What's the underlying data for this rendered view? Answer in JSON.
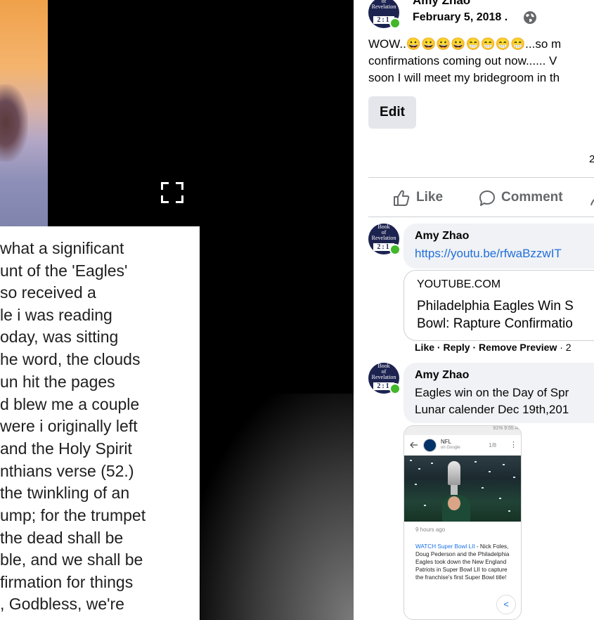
{
  "video": {
    "caption_lines": [
      "what a significant",
      "unt of the 'Eagles'",
      "so received a",
      "le i was reading",
      "oday, was sitting",
      "he word, the clouds",
      "un hit the pages",
      "d blew me a couple",
      "were i originally left",
      "and the Holy Spirit",
      "nthians verse (52.)",
      "the twinkling of an",
      "ump; for the trumpet",
      "the dead shall be",
      "ble, and we shall be",
      "firmation for things",
      ", Godbless, we're"
    ]
  },
  "post": {
    "author": "Amy Zhao",
    "date": "February 5, 2018",
    "date_sep": " . ",
    "avatar": {
      "line1": "Book",
      "line2": "of",
      "line3": "Revelation",
      "number": "2:1"
    },
    "text_lines": [
      "WOW..😀😀😀😀😁😁😁😁...so m",
      "confirmations coming out now...... V",
      "soon I will meet my bridegroom in th"
    ],
    "edit_label": "Edit",
    "reaction_count": "2",
    "actions": {
      "like": "Like",
      "comment": "Comment"
    }
  },
  "comments": [
    {
      "author": "Amy Zhao",
      "link": "https://youtu.be/rfwaBzzwIT",
      "preview": {
        "domain": "YOUTUBE.COM",
        "title_lines": [
          "Philadelphia Eagles Win S",
          "Bowl: Rapture Confirmatio"
        ]
      },
      "meta": {
        "like": "Like",
        "reply": "Reply",
        "remove": "Remove Preview",
        "time": "2"
      }
    },
    {
      "author": "Amy Zhao",
      "text_lines": [
        "Eagles win on the Day of Spr",
        "Lunar calender Dec 19th,201"
      ],
      "screenshot": {
        "status": "91% 9:55 A",
        "source_name": "NFL",
        "source_sub": "on Google",
        "pager": "1/8",
        "time_ago": "9 hours ago",
        "link_text": "WATCH Super Bowl LII",
        "article_text": " - Nick Foles, Doug Pederson and the Philadelphia Eagles took down the New England Patriots in Super Bowl LII to capture the franchise's first Super Bowl title!"
      }
    }
  ],
  "colors": {
    "facebook_green": "#42b72a",
    "link_blue": "#216fdb",
    "text_gray": "#65676b",
    "avatar_navy": "#1c2350"
  },
  "icons": [
    "fullscreen-icon",
    "globe-icon",
    "like-icon",
    "comment-icon",
    "share-icon",
    "back-arrow-icon",
    "more-icon"
  ]
}
